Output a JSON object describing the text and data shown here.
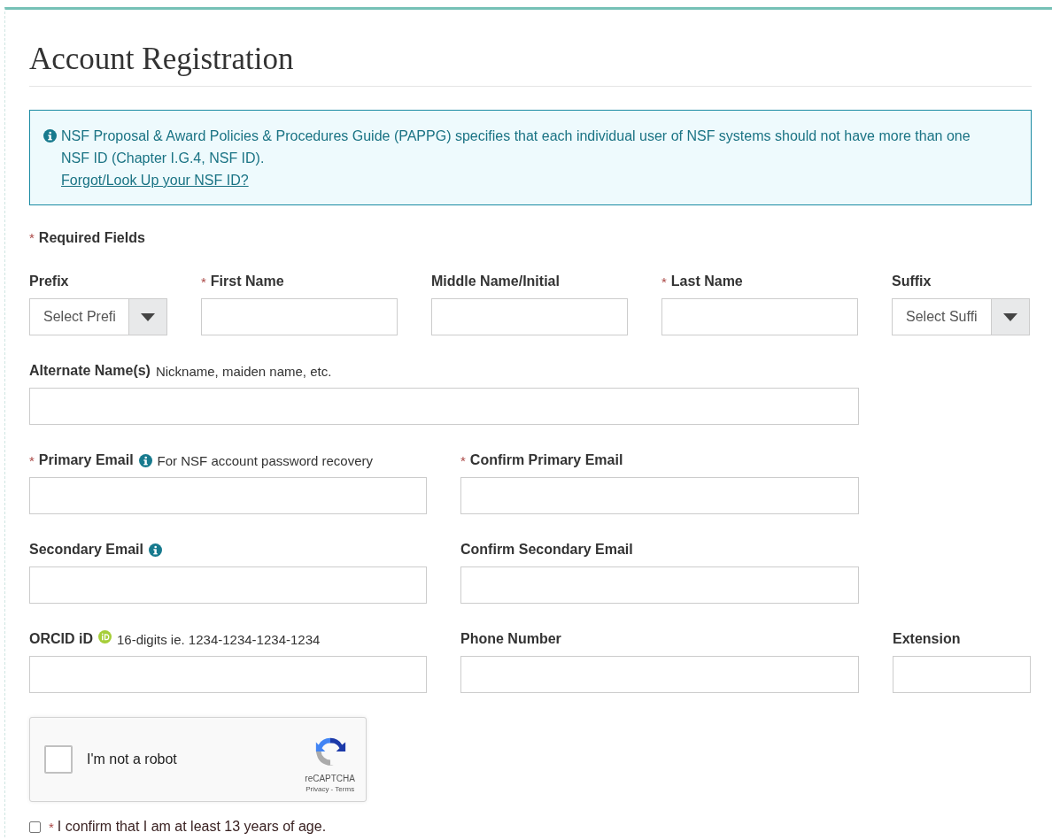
{
  "title": "Account Registration",
  "notice": {
    "text": "NSF Proposal & Award Policies & Procedures Guide (PAPPG) specifies that each individual user of NSF systems should not have more than one NSF ID (Chapter I.G.4, NSF ID).",
    "link": "Forgot/Look Up your NSF ID?"
  },
  "required_note": {
    "marker": "*",
    "text": "Required Fields"
  },
  "rows": [
    {
      "fields": [
        {
          "kind": "select",
          "label": "Prefix",
          "placeholder": "Select Prefi"
        },
        {
          "kind": "text",
          "label": "First Name",
          "required_mark": "*"
        },
        {
          "kind": "text",
          "label": "Middle Name/Initial"
        },
        {
          "kind": "text",
          "label": "Last Name",
          "required_mark": "*"
        },
        {
          "kind": "select",
          "label": "Suffix",
          "placeholder": "Select Suffi"
        }
      ]
    },
    {
      "fields": [
        {
          "kind": "text",
          "label": "Alternate Name(s)",
          "hint": "Nickname, maiden name, etc."
        }
      ]
    },
    {
      "fields": [
        {
          "kind": "text",
          "label": "Primary Email",
          "required_mark": "*",
          "hint": "For NSF account password recovery"
        },
        {
          "kind": "text",
          "label": "Confirm Primary Email",
          "required_mark": "*"
        }
      ]
    },
    {
      "fields": [
        {
          "kind": "text",
          "label": "Secondary Email"
        },
        {
          "kind": "text",
          "label": "Confirm Secondary Email"
        }
      ]
    },
    {
      "fields": [
        {
          "kind": "text",
          "label": "ORCID iD",
          "hint": "16-digits ie. 1234-1234-1234-1234"
        },
        {
          "kind": "text",
          "label": "Phone Number"
        },
        {
          "kind": "text",
          "label": "Extension"
        }
      ]
    }
  ],
  "captcha": {
    "label": "I'm not a robot",
    "checked": false,
    "brand": "reCAPTCHA",
    "links": "Privacy - Terms"
  },
  "age_confirm": {
    "checked": false,
    "required_mark": "*",
    "text": "I confirm that I am at least 13 years of age."
  }
}
